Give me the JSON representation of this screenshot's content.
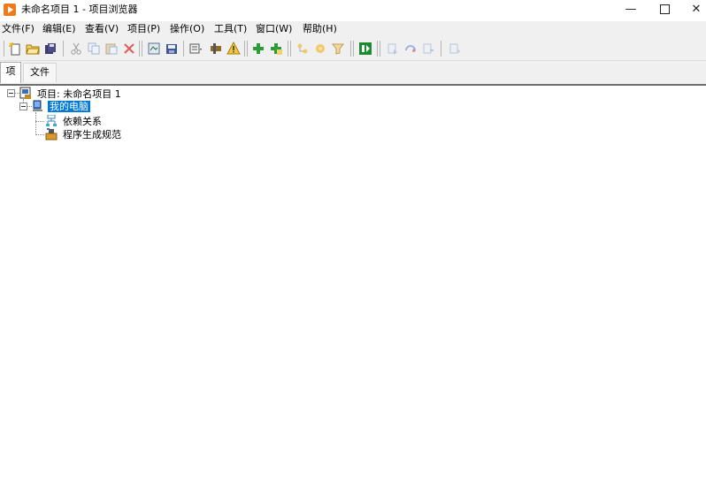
{
  "window": {
    "title": "未命名项目 1 - 项目浏览器",
    "minimize": "—",
    "close": "✕"
  },
  "menu": {
    "items": [
      {
        "label": "文件(F)"
      },
      {
        "label": "编辑(E)"
      },
      {
        "label": "查看(V)"
      },
      {
        "label": "项目(P)"
      },
      {
        "label": "操作(O)"
      },
      {
        "label": "工具(T)"
      },
      {
        "label": "窗口(W)"
      },
      {
        "label": "帮助(H)"
      }
    ]
  },
  "tabs": {
    "items": [
      {
        "label": "项"
      },
      {
        "label": "文件"
      }
    ],
    "active": "项"
  },
  "tree": {
    "root": {
      "label": "项目: 未命名项目 1"
    },
    "computer": {
      "label": "我的电脑"
    },
    "dependencies": {
      "label": "依赖关系"
    },
    "build_specs": {
      "label": "程序生成规范"
    }
  },
  "colors": {
    "accent": "#0078d7",
    "app_icon": "#f07a1a"
  }
}
